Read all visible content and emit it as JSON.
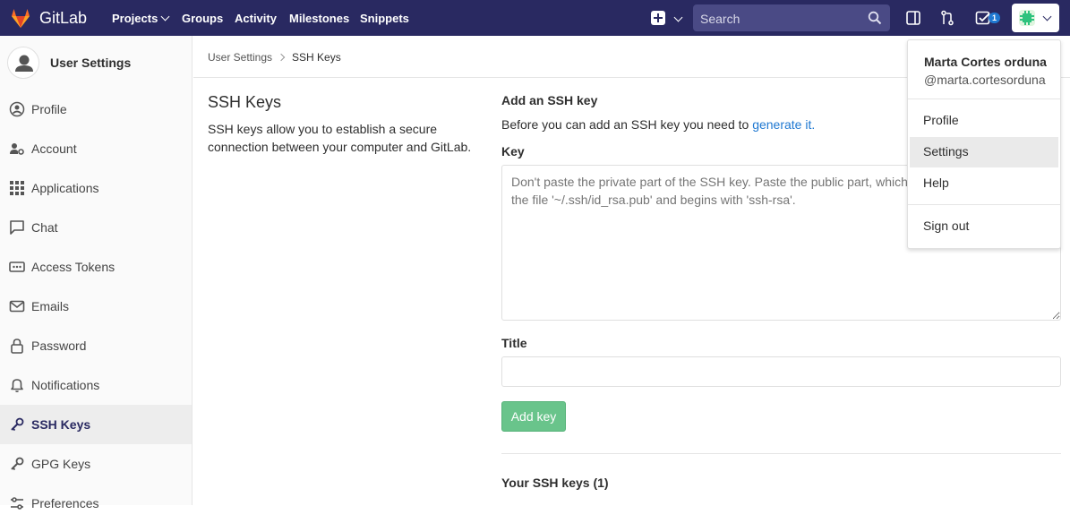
{
  "topnav": {
    "brand": "GitLab",
    "links": [
      "Projects",
      "Groups",
      "Activity",
      "Milestones",
      "Snippets"
    ],
    "search_placeholder": "Search",
    "todo_count": "1",
    "colors": {
      "bg": "#292961",
      "search": "#4a4a85",
      "badge": "#1f78d1"
    }
  },
  "sidebar": {
    "title": "User Settings",
    "items": [
      {
        "label": "Profile",
        "icon": "user-circle-icon"
      },
      {
        "label": "Account",
        "icon": "users-gear-icon"
      },
      {
        "label": "Applications",
        "icon": "grid-icon"
      },
      {
        "label": "Chat",
        "icon": "chat-icon"
      },
      {
        "label": "Access Tokens",
        "icon": "token-icon"
      },
      {
        "label": "Emails",
        "icon": "envelope-icon"
      },
      {
        "label": "Password",
        "icon": "lock-icon"
      },
      {
        "label": "Notifications",
        "icon": "bell-icon"
      },
      {
        "label": "SSH Keys",
        "icon": "key-icon",
        "active": true
      },
      {
        "label": "GPG Keys",
        "icon": "key-icon"
      },
      {
        "label": "Preferences",
        "icon": "sliders-icon"
      }
    ]
  },
  "breadcrumb": {
    "parent": "User Settings",
    "current": "SSH Keys"
  },
  "main": {
    "section_title": "SSH Keys",
    "section_desc": "SSH keys allow you to establish a secure connection between your computer and GitLab.",
    "add_title": "Add an SSH key",
    "add_desc_prefix": "Before you can add an SSH key you need to ",
    "add_desc_link": "generate it.",
    "key_label": "Key",
    "key_placeholder": "Don't paste the private part of the SSH key. Paste the public part, which is usually contained in the file '~/.ssh/id_rsa.pub' and begins with 'ssh-rsa'.",
    "title_label": "Title",
    "title_value": "",
    "add_button": "Add key",
    "your_keys": "Your SSH keys (1)",
    "button_color": "#69c48b",
    "link_color": "#1f78d1"
  },
  "dropdown": {
    "name": "Marta Cortes orduna",
    "username": "@marta.cortesorduna",
    "items": [
      "Profile",
      "Settings",
      "Help",
      "Sign out"
    ],
    "hovered": "Settings"
  }
}
